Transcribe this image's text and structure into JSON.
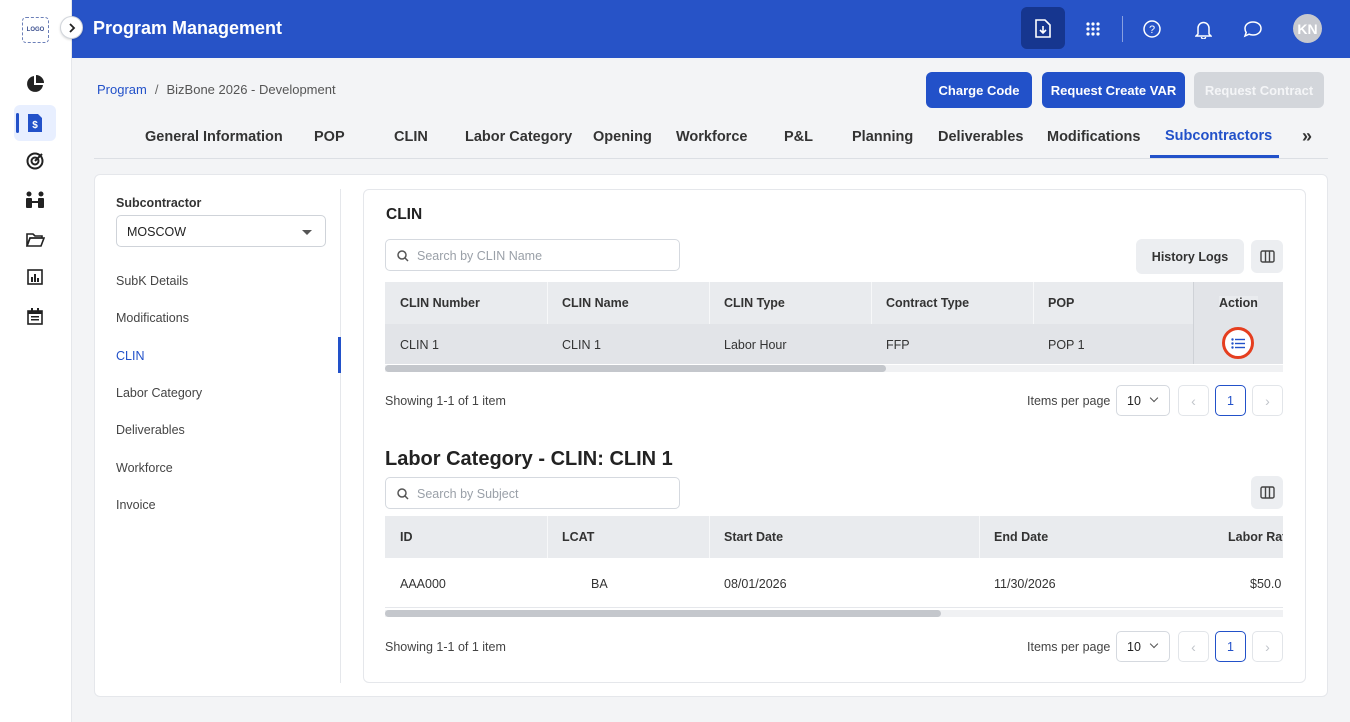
{
  "app": {
    "logo_text": "LOGO",
    "title": "Program Management",
    "avatar_initials": "KN",
    "accent_color": "#2753c7"
  },
  "rail": {
    "icons": [
      "pie-chart-icon",
      "file-dollar-icon",
      "target-icon",
      "people-icon",
      "folder-open-icon",
      "bar-chart-icon",
      "calendar-icon"
    ],
    "active": "file-dollar-icon"
  },
  "header_icons": [
    "download-file-icon",
    "apps-grid-icon",
    "help-icon",
    "bell-icon",
    "chat-icon"
  ],
  "breadcrumb": {
    "root": "Program",
    "separator": "/",
    "current": "BizBone 2026 - Development"
  },
  "actions": {
    "charge_code": "Charge Code",
    "request_var": "Request Create VAR",
    "request_contract": "Request Contract"
  },
  "tabs": [
    {
      "label": "General Information"
    },
    {
      "label": "POP"
    },
    {
      "label": "CLIN"
    },
    {
      "label": "Labor Category"
    },
    {
      "label": "Opening"
    },
    {
      "label": "Workforce"
    },
    {
      "label": "P&L"
    },
    {
      "label": "Planning"
    },
    {
      "label": "Deliverables"
    },
    {
      "label": "Modifications"
    },
    {
      "label": "Subcontractors",
      "active": true
    }
  ],
  "tabs_more": "»",
  "sidebar": {
    "subcontractor_label": "Subcontractor",
    "subcontractor_value": "MOSCOW",
    "items": [
      {
        "label": "SubK Details"
      },
      {
        "label": "Modifications"
      },
      {
        "label": "CLIN",
        "active": true
      },
      {
        "label": "Labor Category"
      },
      {
        "label": "Deliverables"
      },
      {
        "label": "Workforce"
      },
      {
        "label": "Invoice"
      }
    ]
  },
  "clin_section": {
    "title": "CLIN",
    "search_placeholder": "Search by CLIN Name",
    "history_logs": "History Logs",
    "columns": [
      "CLIN Number",
      "CLIN Name",
      "CLIN Type",
      "Contract Type",
      "POP",
      "Action"
    ],
    "rows": [
      {
        "clin_number": "CLIN 1",
        "clin_name": "CLIN 1",
        "clin_type": "Labor Hour",
        "contract_type": "FFP",
        "pop": "POP 1"
      }
    ],
    "showing": "Showing 1-1 of 1 item",
    "items_per_page_label": "Items per page",
    "items_per_page": "10",
    "page": "1"
  },
  "labor_section": {
    "title": "Labor Category - CLIN: CLIN 1",
    "search_placeholder": "Search by Subject",
    "columns": [
      "ID",
      "LCAT",
      "Start Date",
      "End Date",
      "Labor Rat"
    ],
    "rows": [
      {
        "id": "AAA000",
        "lcat": "BA",
        "start_date": "08/01/2026",
        "end_date": "11/30/2026",
        "labor_rate": "$50.0"
      }
    ],
    "showing": "Showing 1-1 of 1 item",
    "items_per_page_label": "Items per page",
    "items_per_page": "10",
    "page": "1"
  }
}
